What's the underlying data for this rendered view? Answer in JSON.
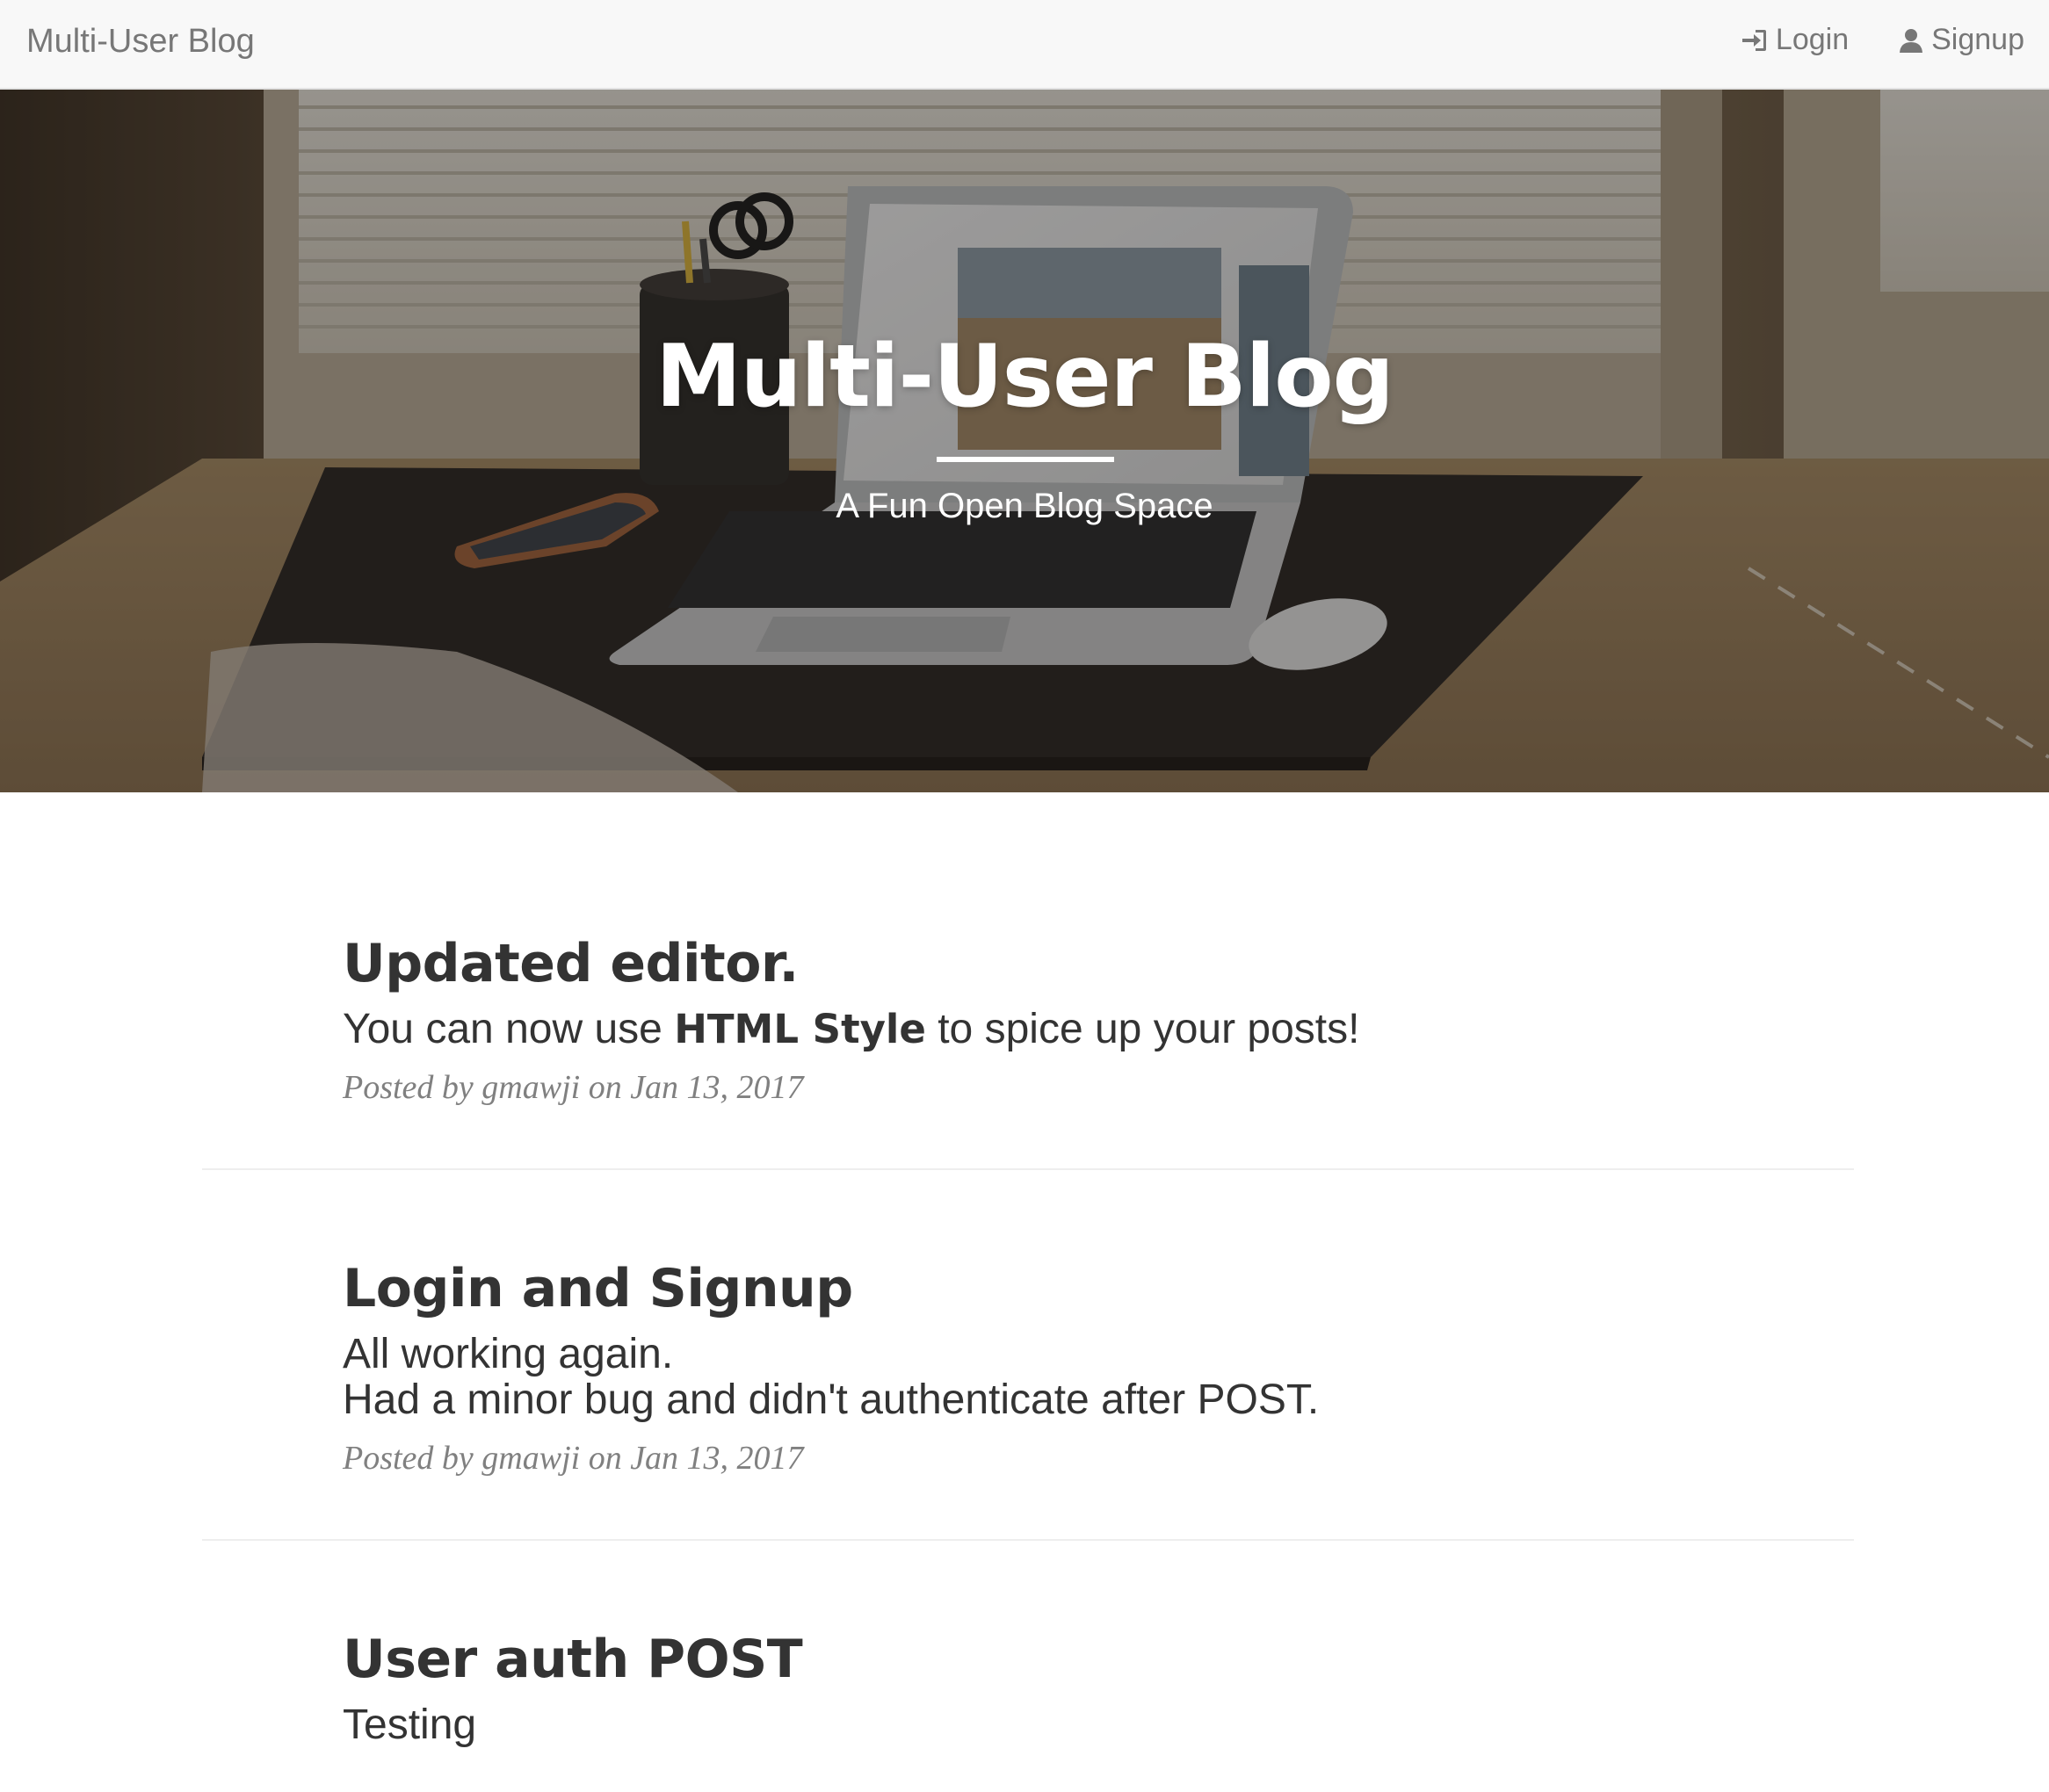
{
  "navbar": {
    "brand": "Multi-User Blog",
    "login_label": "Login",
    "signup_label": "Signup"
  },
  "hero": {
    "title": "Multi-User Blog",
    "subtitle": "A Fun Open Blog Space"
  },
  "posts": [
    {
      "title": "Updated editor.",
      "body_prefix": "You can now use ",
      "body_bold": "HTML Style",
      "body_suffix": " to spice up your posts!",
      "meta": "Posted by gmawji on Jan 13, 2017"
    },
    {
      "title": "Login and Signup",
      "body_lines": [
        "All working again.",
        "Had a minor bug and didn't authenticate after POST."
      ],
      "meta": "Posted by gmawji on Jan 13, 2017"
    },
    {
      "title": "User auth POST",
      "body_lines": [
        "Testing"
      ]
    }
  ],
  "icons": {
    "login": "sign-in-icon",
    "signup": "user-icon"
  },
  "colors": {
    "navbar_bg": "#f8f8f8",
    "nav_text": "#777777",
    "heading": "#333333",
    "meta": "#808080",
    "hero_text": "#ffffff"
  }
}
